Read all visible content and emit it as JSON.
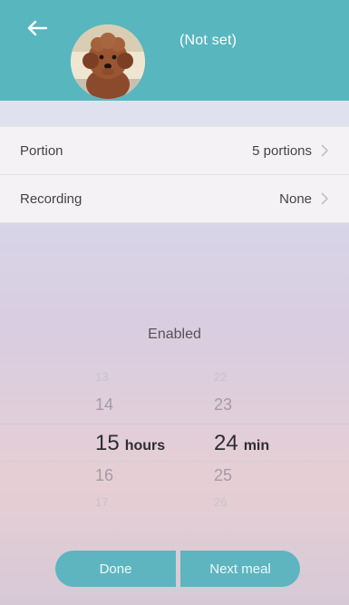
{
  "header": {
    "title": "(Not set)",
    "back_icon": "arrow-left-icon",
    "background": "#58b6bf"
  },
  "settings": {
    "portion": {
      "label": "Portion",
      "value": "5 portions"
    },
    "recording": {
      "label": "Recording",
      "value": "None"
    }
  },
  "status": {
    "enabled": "Enabled"
  },
  "picker": {
    "hours": {
      "far_above": "13",
      "above": "14",
      "selected": "15",
      "unit": "hours",
      "below": "16",
      "far_below": "17"
    },
    "minutes": {
      "far_above": "22",
      "above": "23",
      "selected": "24",
      "unit": "min",
      "below": "25",
      "far_below": "26"
    }
  },
  "buttons": {
    "done": "Done",
    "next_meal": "Next meal",
    "color": "#5eb5bf"
  }
}
